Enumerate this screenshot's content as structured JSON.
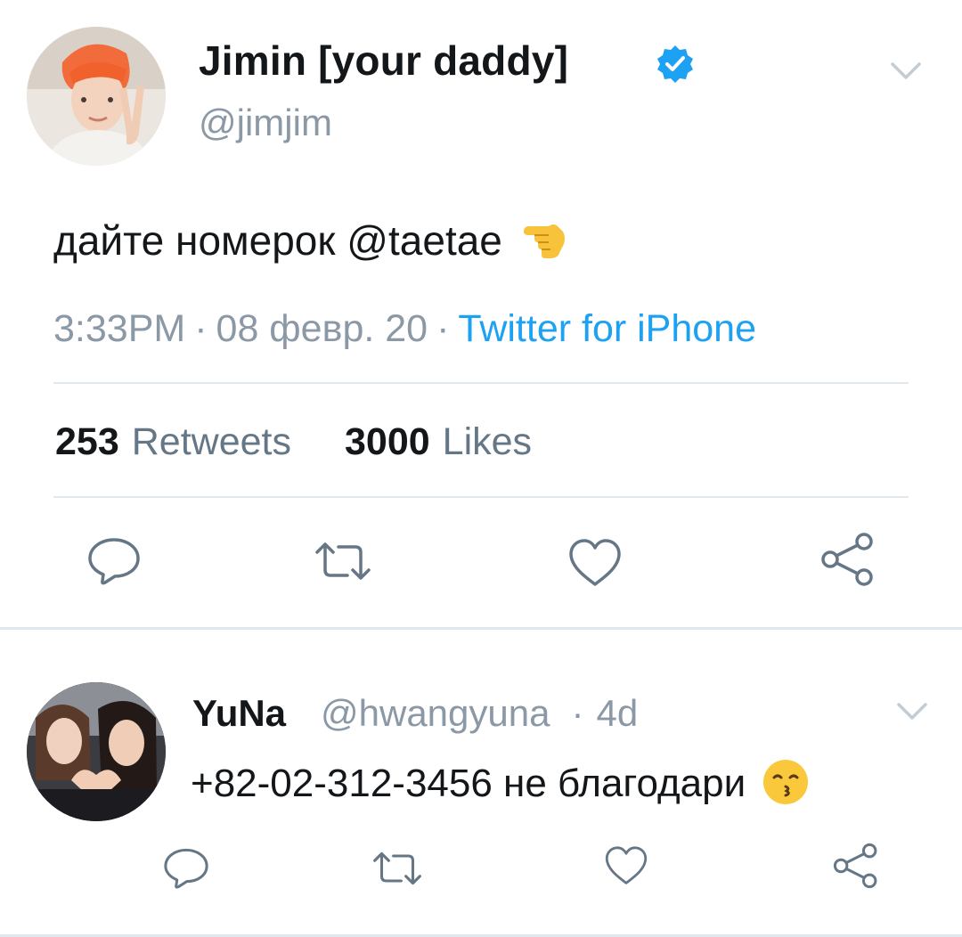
{
  "tweet": {
    "author": {
      "display_name": "Jimin [your daddy]",
      "handle": "@jimjim",
      "verified": true,
      "avatar": "avatar-photo-red-hair"
    },
    "text": "дайте номерок @taetae",
    "text_emoji": "backhand-index-pointing-left-emoji",
    "time": "3:33PM",
    "date": "08 февр. 20",
    "separator": "·",
    "source": "Twitter for iPhone",
    "retweets_count": "253",
    "retweets_label": "Retweets",
    "likes_count": "3000",
    "likes_label": "Likes",
    "actions": [
      "reply-icon",
      "retweet-icon",
      "like-icon",
      "share-icon"
    ]
  },
  "reply": {
    "author": {
      "display_name": "YuNa",
      "handle": "@hwangyuna",
      "avatar": "avatar-photo-two-girls"
    },
    "separator": "·",
    "age": "4d",
    "text": "+82-02-312-3456 не благодари",
    "text_emoji": "kissing-face-emoji",
    "actions": [
      "reply-icon",
      "retweet-icon",
      "like-icon",
      "share-icon"
    ]
  },
  "colors": {
    "accent": "#1da1f2",
    "text": "#14171a",
    "muted": "#8b98a5",
    "divider": "#e1e8ed",
    "icon": "#657786"
  }
}
